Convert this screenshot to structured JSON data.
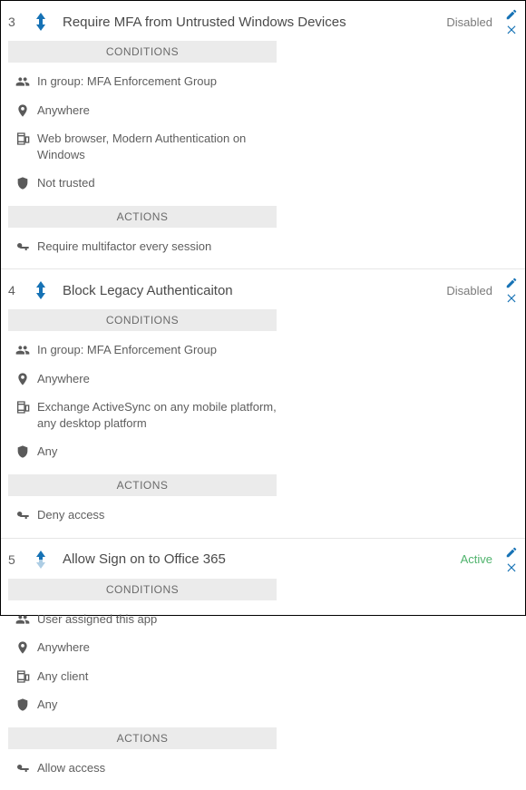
{
  "headings": {
    "conditions": "CONDITIONS",
    "actions": "ACTIONS"
  },
  "rules": [
    {
      "number": "3",
      "title": "Require MFA from Untrusted Windows Devices",
      "status_label": "Disabled",
      "status_kind": "disabled",
      "up_faded": false,
      "down_faded": false,
      "conditions": [
        {
          "icon": "group",
          "text": "In group: MFA Enforcement Group"
        },
        {
          "icon": "pin",
          "text": "Anywhere"
        },
        {
          "icon": "device",
          "text": "Web browser, Modern Authentication on Windows"
        },
        {
          "icon": "shield",
          "text": "Not trusted"
        }
      ],
      "actions": [
        {
          "icon": "key",
          "text": "Require multifactor every session"
        }
      ]
    },
    {
      "number": "4",
      "title": "Block Legacy Authenticaiton",
      "status_label": "Disabled",
      "status_kind": "disabled",
      "up_faded": false,
      "down_faded": false,
      "conditions": [
        {
          "icon": "group",
          "text": "In group: MFA Enforcement Group"
        },
        {
          "icon": "pin",
          "text": "Anywhere"
        },
        {
          "icon": "device",
          "text": "Exchange ActiveSync on any mobile platform, any desktop platform"
        },
        {
          "icon": "shield",
          "text": "Any"
        }
      ],
      "actions": [
        {
          "icon": "key",
          "text": "Deny access"
        }
      ]
    },
    {
      "number": "5",
      "title": "Allow Sign on to Office 365",
      "status_label": "Active",
      "status_kind": "active",
      "up_faded": false,
      "down_faded": true,
      "conditions": [
        {
          "icon": "group",
          "text": "User assigned this app"
        },
        {
          "icon": "pin",
          "text": "Anywhere"
        },
        {
          "icon": "device",
          "text": "Any client"
        },
        {
          "icon": "shield",
          "text": "Any"
        }
      ],
      "actions": [
        {
          "icon": "key",
          "text": "Allow access"
        }
      ]
    }
  ]
}
